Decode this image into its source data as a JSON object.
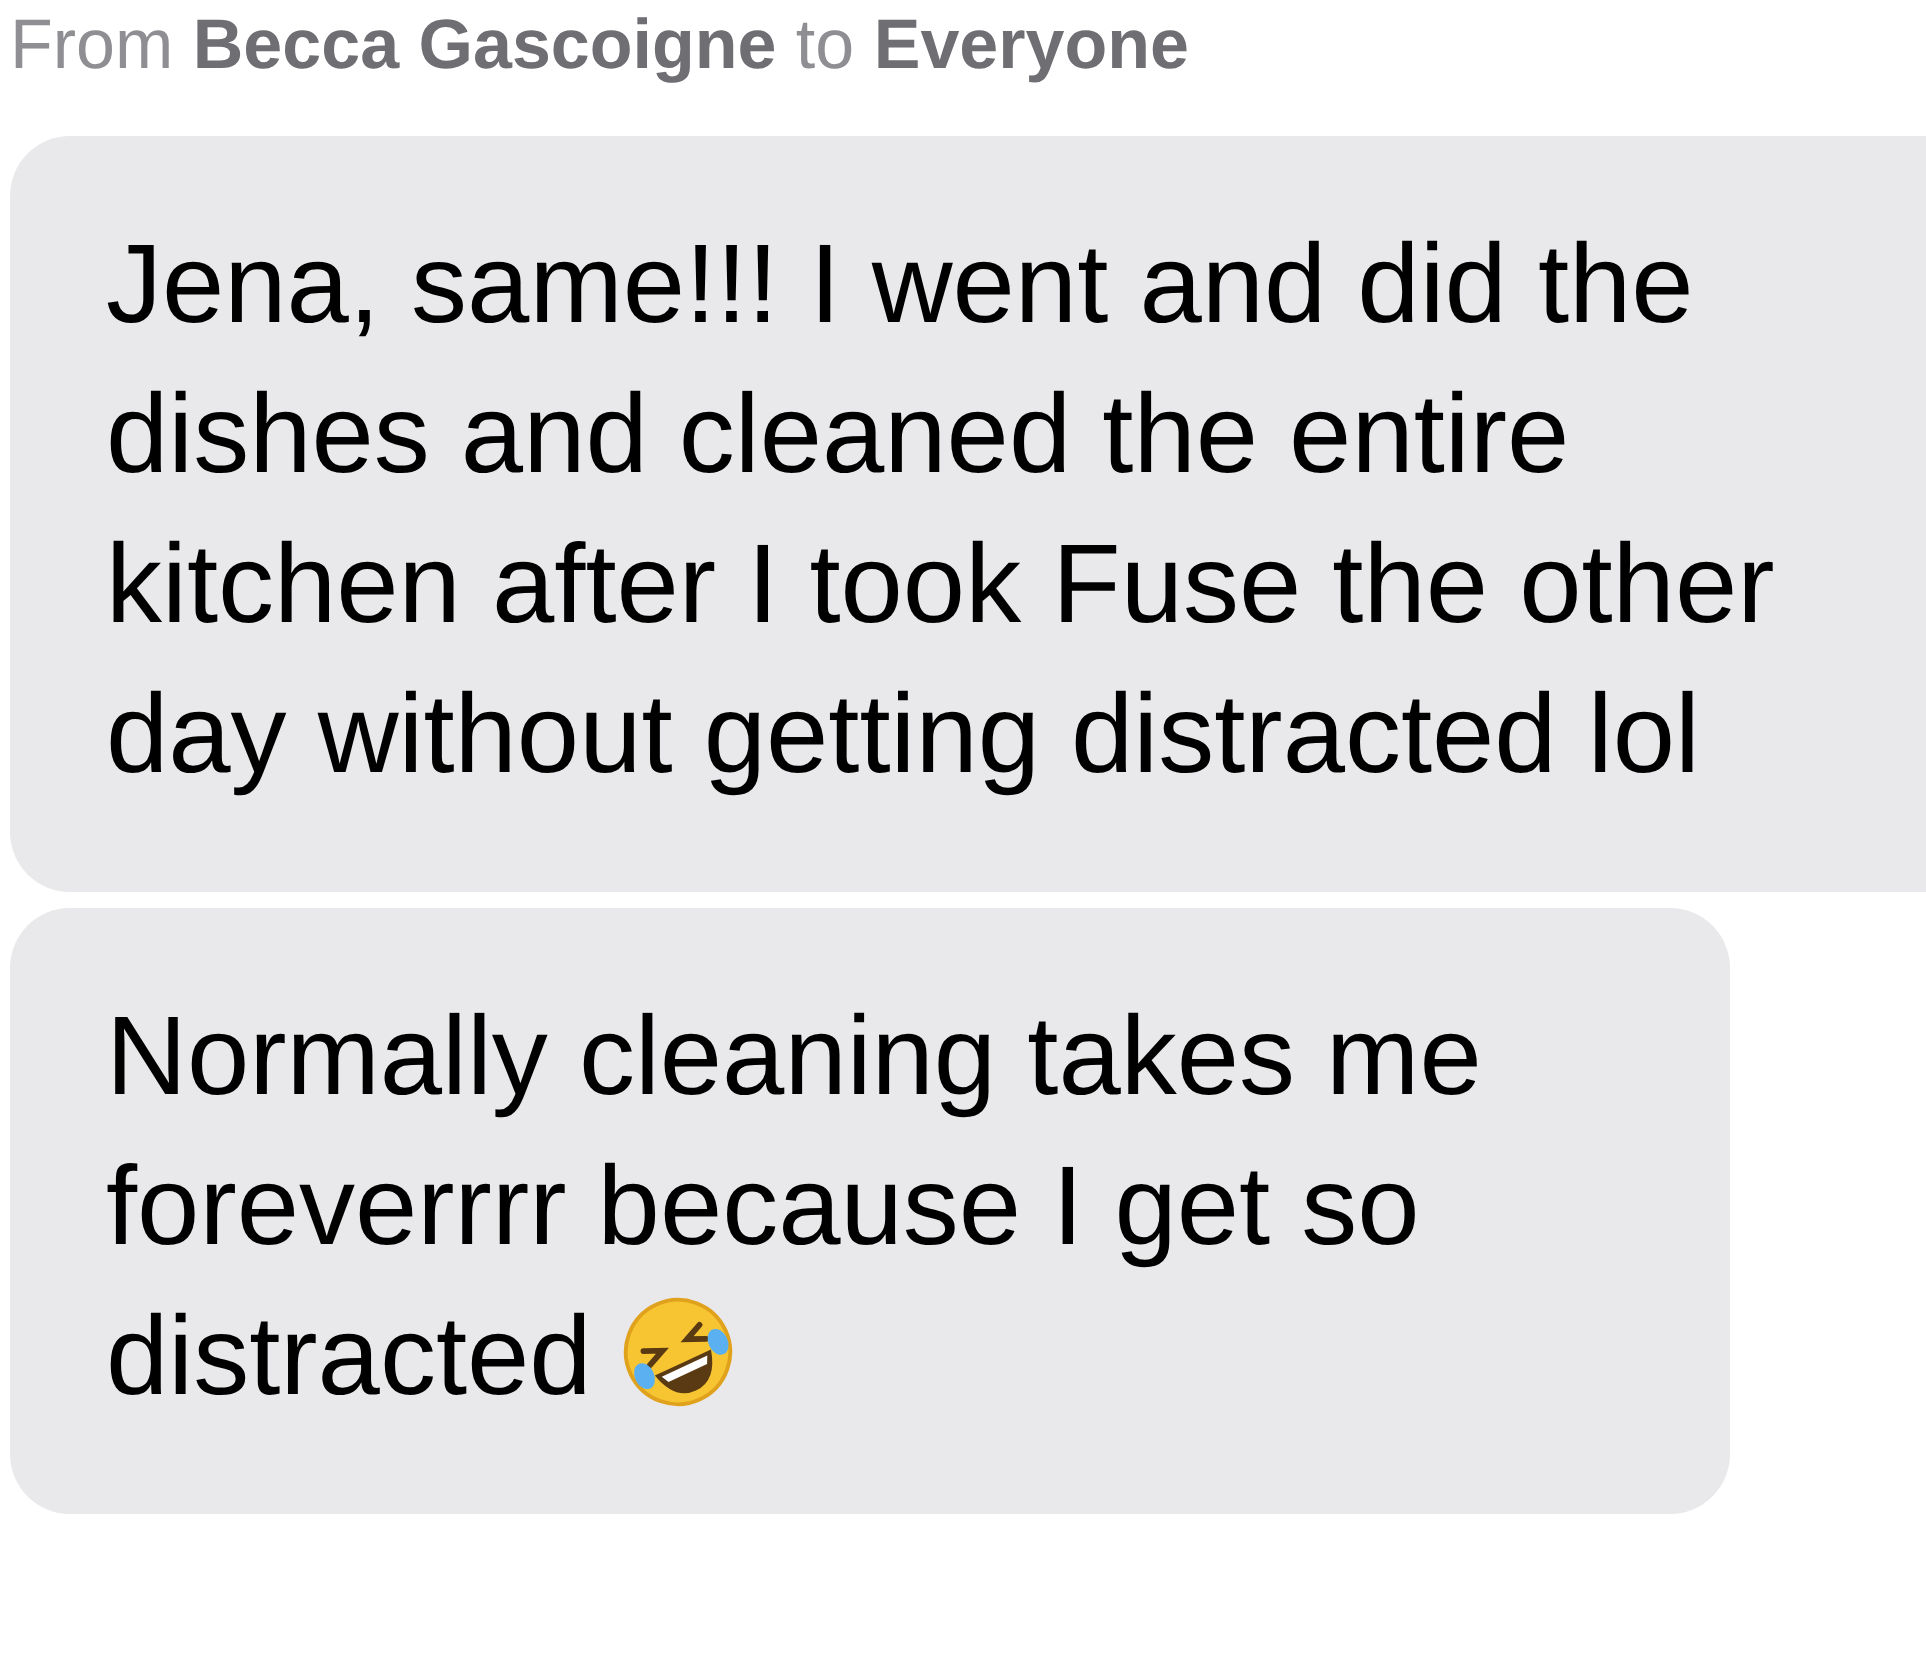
{
  "header": "From **Becca Gascoigne** to **Everyone**",
  "messages": [
    {
      "text": "Jena, same!!! I went and did the dishes and cleaned the entire kitchen after I took Fuse the other day without getting distracted lol",
      "emoji": false
    },
    {
      "text": "Normally cleaning takes me foreverrrr because I get so distracted",
      "emoji": true
    }
  ]
}
